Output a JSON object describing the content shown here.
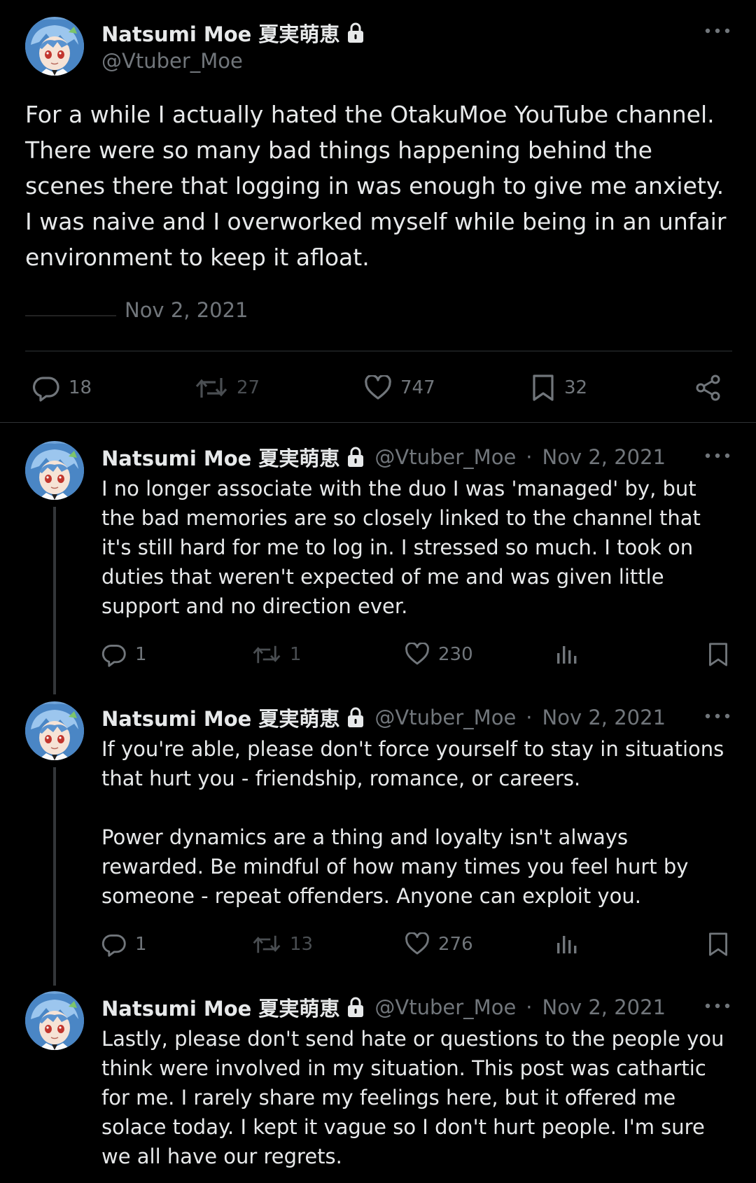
{
  "main_post": {
    "author_name": "Natsumi Moe 夏実萌恵",
    "handle": "@Vtuber_Moe",
    "body": "For a while I actually hated the OtakuMoe YouTube channel. There were so many bad things happening behind the scenes there that logging in was enough to give me anxiety. I was naive and I overworked myself while being in an unfair environment to keep it afloat.",
    "date": "Nov 2, 2021",
    "replies": "18",
    "reposts": "27",
    "likes": "747",
    "bookmarks": "32"
  },
  "thread": [
    {
      "author_name": "Natsumi Moe 夏実萌恵",
      "handle": "@Vtuber_Moe",
      "date": "Nov 2, 2021",
      "body": "I no longer associate with the duo I was 'managed' by, but the bad memories are so closely linked to the channel that it's still hard for me to log in. I stressed so much. I took on duties that weren't expected of me and was given little support and no direction ever.",
      "replies": "1",
      "reposts": "1",
      "likes": "230"
    },
    {
      "author_name": "Natsumi Moe 夏実萌恵",
      "handle": "@Vtuber_Moe",
      "date": "Nov 2, 2021",
      "body": "If you're able, please don't force yourself to stay in situations that hurt you - friendship, romance, or careers.\n\nPower dynamics are a thing and loyalty isn't always rewarded. Be mindful of how many times you feel hurt by someone - repeat offenders. Anyone can exploit you.",
      "replies": "1",
      "reposts": "13",
      "likes": "276"
    },
    {
      "author_name": "Natsumi Moe 夏実萌恵",
      "handle": "@Vtuber_Moe",
      "date": "Nov 2, 2021",
      "body": "Lastly, please don't send hate or questions to the people you think were involved in my situation. This post was cathartic for me. I rarely share my feelings here, but it offered me solace today. I kept it vague so I don't hurt people. I'm sure we all have our regrets."
    }
  ],
  "separator": "·",
  "colors": {
    "background": "#000000",
    "text": "#e7e9ea",
    "muted": "#71767b",
    "divider": "#2f3336"
  },
  "icons": [
    "avatar",
    "lock-icon",
    "more-icon",
    "reply-icon",
    "repost-icon",
    "like-icon",
    "bookmark-icon",
    "share-icon",
    "views-icon"
  ]
}
